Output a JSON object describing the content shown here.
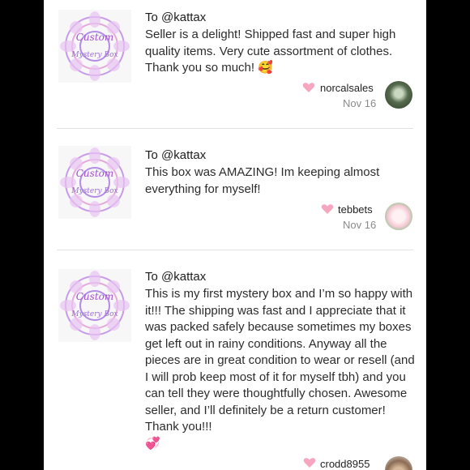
{
  "reviews": [
    {
      "to": "To @kattax",
      "text": "Seller is a delight! Shipped fast and super high quality items. Very cute assortment of clothes. Thank you so much!",
      "emoji": "🥰",
      "user": "norcalsales",
      "date": "Nov 16",
      "logo_text": [
        "Custom",
        "Mystery Box"
      ]
    },
    {
      "to": "To @kattax",
      "text": "This box was AMAZING! Im keeping almost everything for myself!",
      "emoji": "",
      "user": "tebbets",
      "date": "Nov 16",
      "logo_text": [
        "Custom",
        "Mystery Box"
      ]
    },
    {
      "to": "To @kattax",
      "text": "This is my first mystery box and I’m so happy with it!!! The shipping was fast and I appreciate that it was packed safely because sometimes my boxes get left out in rainy conditions. Anyway all the pieces are in great condition to wear or resell (and I will prob keep most of it for myself tbh) and you can tell they were thoughtfully chosen. Awesome seller, and I’ll definitely be a return customer! Thank you!!!",
      "emoji": "💞",
      "user": "crodd8955",
      "date": "",
      "logo_text": [
        "Custom",
        "Mystery Box"
      ]
    }
  ],
  "colors": {
    "heart": "#f7a6bf",
    "divider": "#e2e2e2",
    "date": "#8a8a8a"
  },
  "icons": [
    "heart-icon",
    "mandala-logo",
    "avatar"
  ]
}
